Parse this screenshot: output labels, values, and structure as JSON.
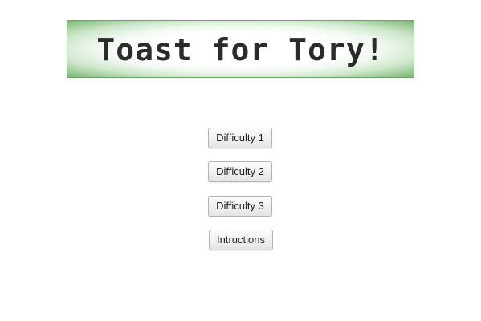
{
  "title": "Toast for Tory!",
  "colors": {
    "banner_border": "#6aa866",
    "banner_glow": "#7db777",
    "banner_center": "#ffffff",
    "title_text": "#2b2b2b",
    "button_text": "#222222",
    "button_border": "#b3b3b3"
  },
  "menu": {
    "difficulty_1": "Difficulty 1",
    "difficulty_2": "Difficulty 2",
    "difficulty_3": "Difficulty 3",
    "instructions": "Intructions"
  }
}
